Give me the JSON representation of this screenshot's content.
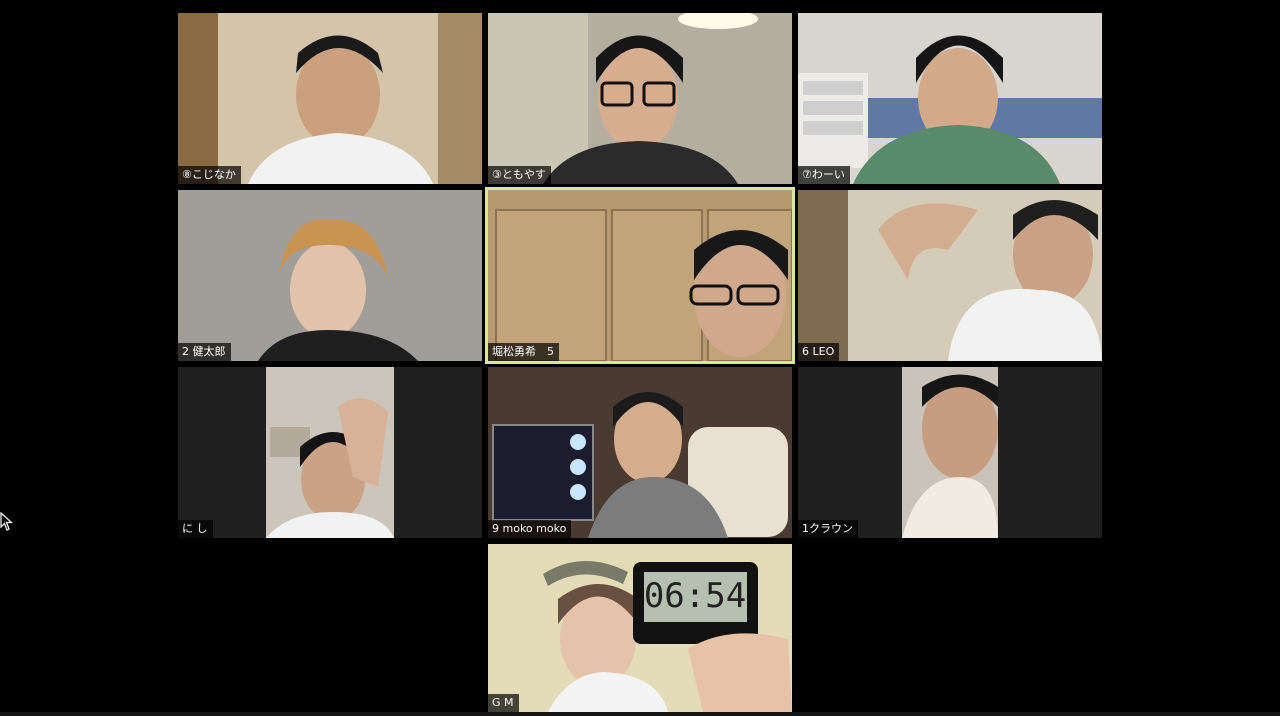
{
  "window": {
    "app": "Zoom",
    "view": "gallery-view"
  },
  "participants": [
    {
      "id": "t1",
      "name": "⑧こじなか",
      "active": false,
      "bg": "#c9b79a"
    },
    {
      "id": "t2",
      "name": "③ともやす",
      "active": false,
      "bg": "#b8b3a6"
    },
    {
      "id": "t3",
      "name": "⑦わーい",
      "active": false,
      "bg": "#c7c2ba"
    },
    {
      "id": "t4",
      "name": "2 健太郎",
      "active": false,
      "bg": "#9c9893"
    },
    {
      "id": "t5",
      "name": "堀松勇希　5",
      "active": true,
      "bg": "#b39266"
    },
    {
      "id": "t6",
      "name": "6 LEO",
      "active": false,
      "bg": "#c5bca8"
    },
    {
      "id": "t7",
      "name": "に し",
      "active": false,
      "bg": "#1f1f1f"
    },
    {
      "id": "t8",
      "name": "9  moko moko",
      "active": false,
      "bg": "#4a3a30"
    },
    {
      "id": "t9",
      "name": "1クラウン",
      "active": false,
      "bg": "#1f1f1f"
    },
    {
      "id": "t10",
      "name": "G M",
      "active": false,
      "bg": "#e4ddba"
    }
  ],
  "timer_display": "06:54",
  "colors": {
    "background": "#000000",
    "active_speaker_border": "#d8e89a",
    "label_bg": "rgba(0,0,0,0.7)",
    "label_text": "#ffffff"
  },
  "icons": {
    "cursor": "mouse-pointer-icon"
  }
}
